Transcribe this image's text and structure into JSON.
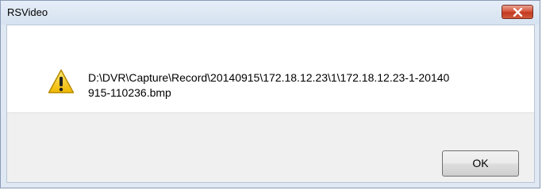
{
  "window": {
    "title": "RSVideo"
  },
  "message": {
    "text": "D:\\DVR\\Capture\\Record\\20140915\\172.18.12.23\\1\\172.18.12.23-1-20140\n915-110236.bmp",
    "icon": "warning-icon"
  },
  "buttons": {
    "ok_label": "OK",
    "close_icon": "close-icon"
  },
  "colors": {
    "titlebar": "#dfe8f3",
    "close_button": "#c8452b",
    "footer": "#f0f0f0",
    "warning_yellow": "#f5c400"
  }
}
